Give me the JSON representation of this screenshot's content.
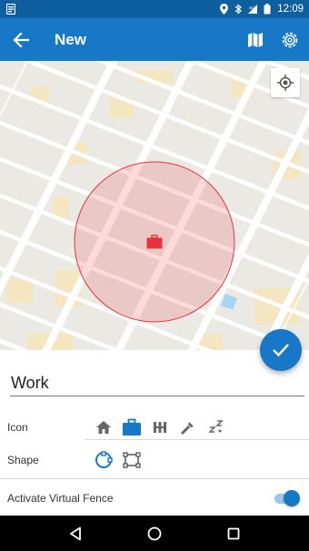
{
  "status_bar": {
    "time": "12:09",
    "icons": [
      "notification-icon",
      "location-icon",
      "bluetooth-icon",
      "signal-icon",
      "battery-icon"
    ]
  },
  "app_bar": {
    "title": "New",
    "icons": [
      "back-arrow-icon",
      "map-icon",
      "settings-icon"
    ]
  },
  "map": {
    "accent": "#e8323c",
    "fence_fill": "rgba(232,50,60,0.18)",
    "pin_icon": "briefcase-icon"
  },
  "form": {
    "name_value": "Work",
    "icon_label": "Icon",
    "icon_options": [
      "home-icon",
      "briefcase-icon",
      "gym-icon",
      "tools-icon",
      "sleep-icon"
    ],
    "selected_icon": "briefcase-icon",
    "shape_label": "Shape",
    "shape_options": [
      "circle-shape-icon",
      "rectangle-shape-icon"
    ],
    "selected_shape": "circle-shape-icon",
    "fence_label": "Activate Virtual Fence",
    "fence_enabled": true
  },
  "colors": {
    "primary": "#1778c8",
    "status_bar": "#0d5f9e",
    "nav_bar": "#000000"
  }
}
